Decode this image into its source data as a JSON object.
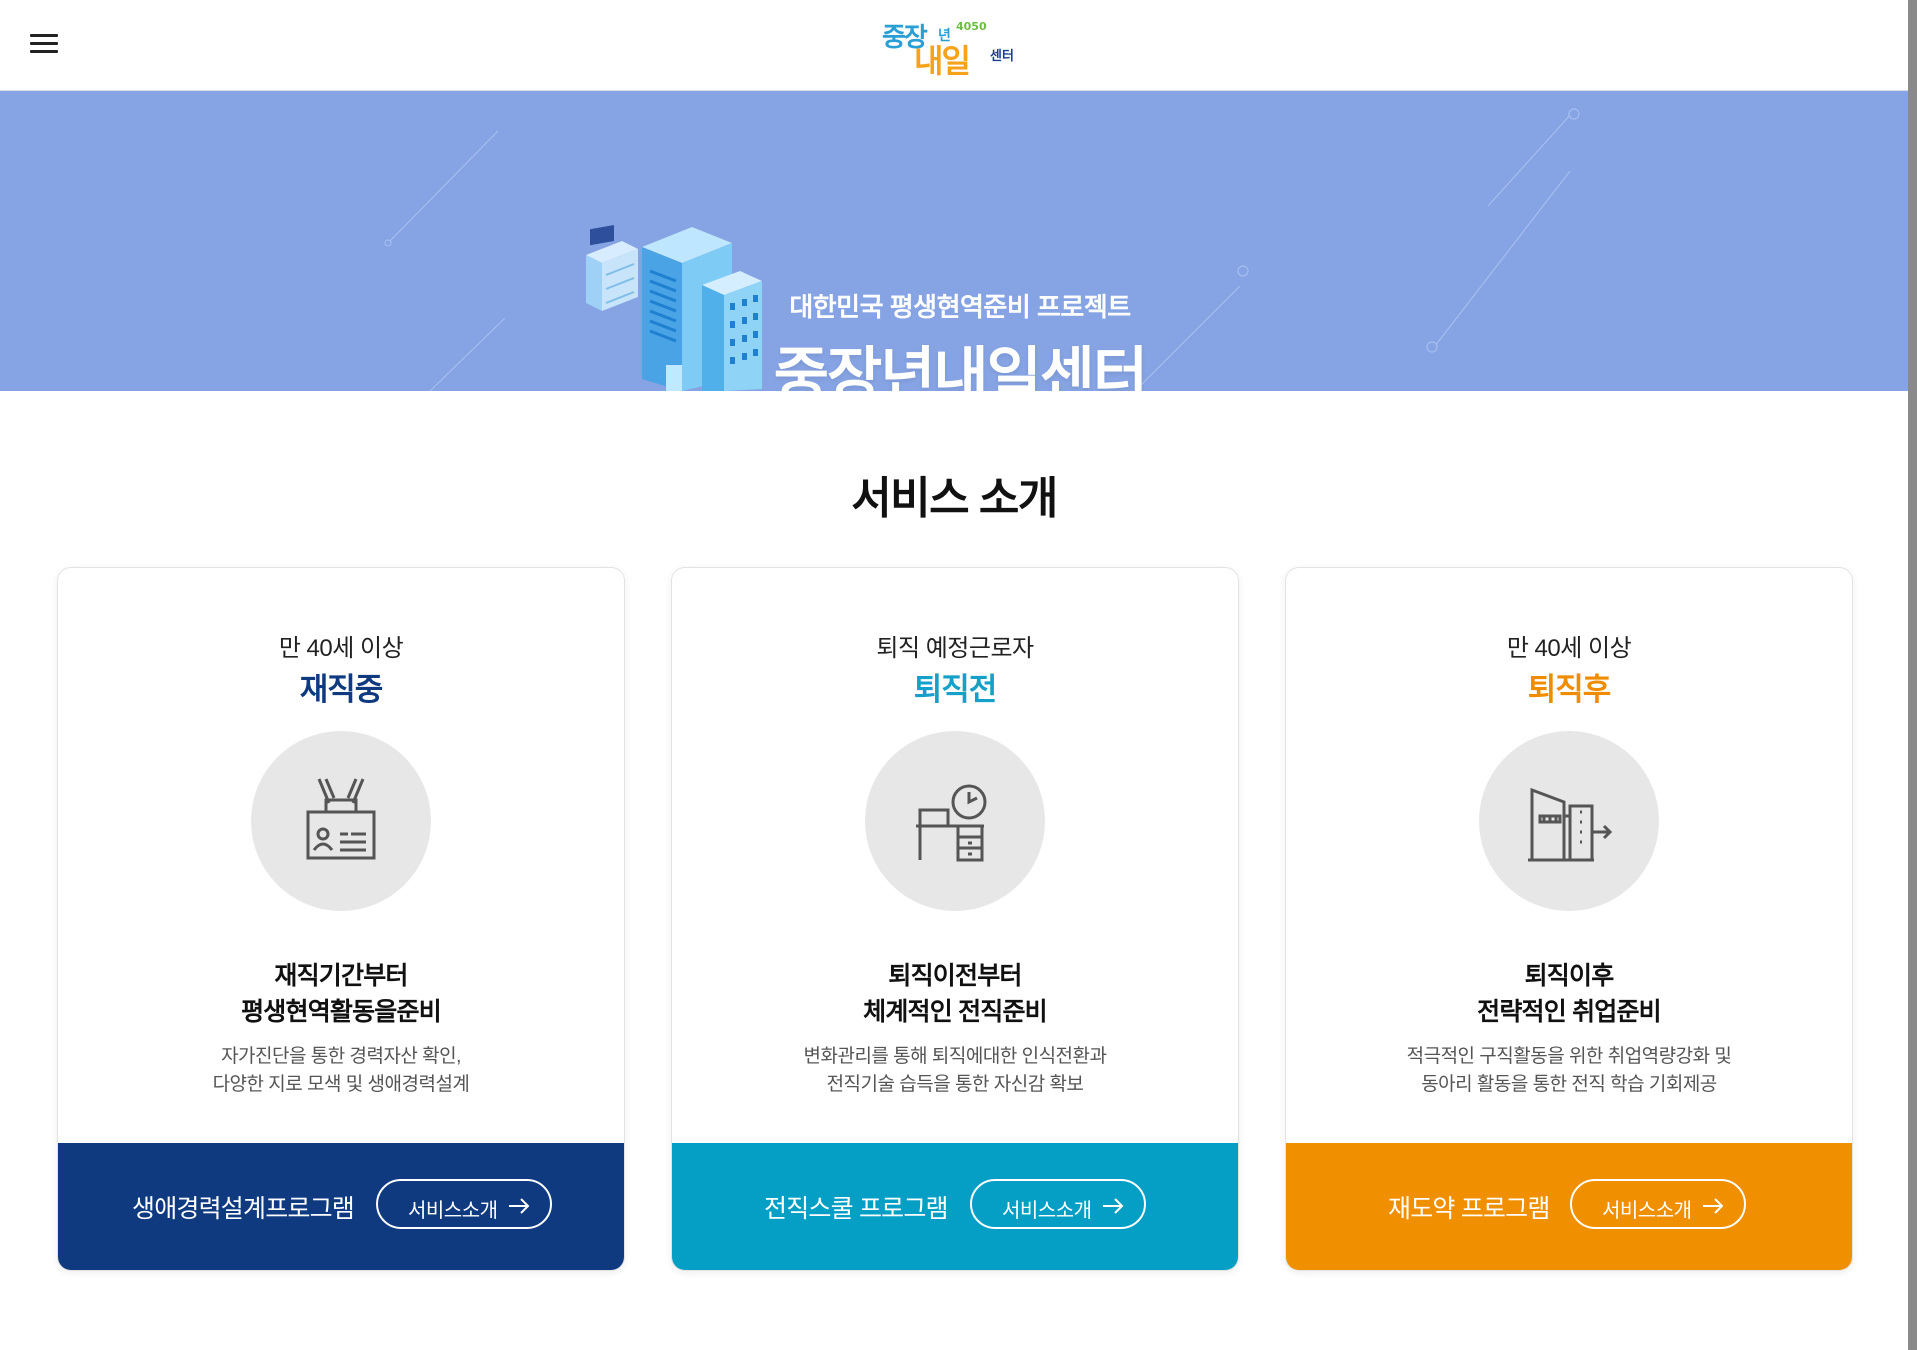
{
  "header": {
    "logo_text": "중장년 내일센터",
    "logo_badge": "4050"
  },
  "banner": {
    "kicker": "대한민국 평생현역준비 프로젝트",
    "title": "중장년내일센터",
    "background_color": "#86a3e3"
  },
  "section": {
    "title": "서비스 소개"
  },
  "cards": [
    {
      "target": "만 40세 이상",
      "stage": "재직중",
      "stage_color": "#0f3a80",
      "icon": "id-badge-icon",
      "headline_line1": "재직기간부터",
      "headline_line2": "평생현역활동을준비",
      "desc_line1": "자가진단을 통한 경력자산 확인,",
      "desc_line2": "다양한 지로 모색 및 생애경력설계",
      "program": "생애경력설계프로그램",
      "service_button": "서비스소개",
      "footer_color": "#0f3a80"
    },
    {
      "target": "퇴직 예정근로자",
      "stage": "퇴직전",
      "stage_color": "#14a0c8",
      "icon": "desk-clock-icon",
      "headline_line1": "퇴직이전부터",
      "headline_line2": "체계적인 전직준비",
      "desc_line1": "변화관리를 통해 퇴직에대한 인식전환과",
      "desc_line2": "전직기술 습득을 통한 자신감 확보",
      "program": "전직스쿨 프로그램",
      "service_button": "서비스소개",
      "footer_color": "#059fc6"
    },
    {
      "target": "만 40세 이상",
      "stage": "퇴직후",
      "stage_color": "#f08c00",
      "icon": "building-exit-icon",
      "headline_line1": "퇴직이후",
      "headline_line2": "전략적인 취업준비",
      "desc_line1": "적극적인 구직활동을 위한 취업역량강화 및",
      "desc_line2": "동아리 활동을 통한 전직 학습 기회제공",
      "program": "재도약 프로그램",
      "service_button": "서비스소개",
      "footer_color": "#f08f00"
    }
  ]
}
